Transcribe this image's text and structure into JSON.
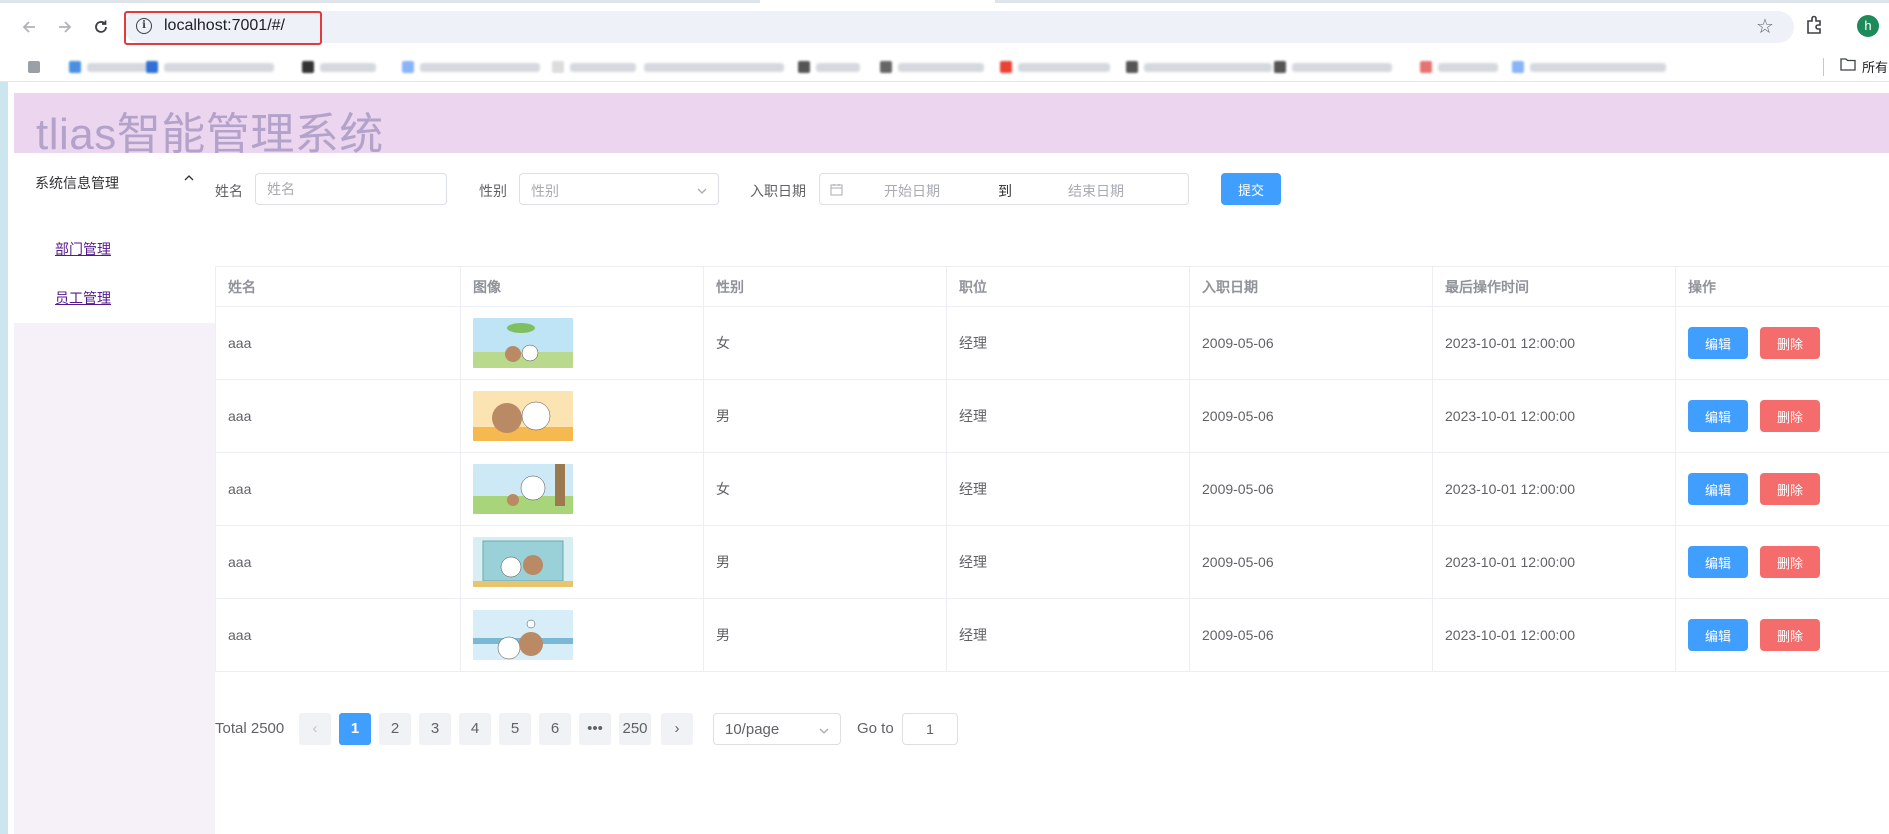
{
  "browser": {
    "url": "localhost:7001/#/",
    "profile_initial": "h",
    "all_bookmarks_label": "所有"
  },
  "app": {
    "title": "tlias智能管理系统"
  },
  "sidebar": {
    "group_title": "系统信息管理",
    "items": [
      {
        "label": "部门管理"
      },
      {
        "label": "员工管理"
      }
    ]
  },
  "search": {
    "name_label": "姓名",
    "name_placeholder": "姓名",
    "gender_label": "性别",
    "gender_placeholder": "性别",
    "date_label": "入职日期",
    "start_placeholder": "开始日期",
    "range_separator": "到",
    "end_placeholder": "结束日期",
    "submit_label": "提交"
  },
  "table": {
    "columns": [
      "姓名",
      "图像",
      "性别",
      "职位",
      "入职日期",
      "最后操作时间",
      "操作"
    ],
    "edit_label": "编辑",
    "delete_label": "删除",
    "rows": [
      {
        "name": "aaa",
        "gender": "女",
        "job": "经理",
        "entry_date": "2009-05-06",
        "update_time": "2023-10-01 12:00:00"
      },
      {
        "name": "aaa",
        "gender": "男",
        "job": "经理",
        "entry_date": "2009-05-06",
        "update_time": "2023-10-01 12:00:00"
      },
      {
        "name": "aaa",
        "gender": "女",
        "job": "经理",
        "entry_date": "2009-05-06",
        "update_time": "2023-10-01 12:00:00"
      },
      {
        "name": "aaa",
        "gender": "男",
        "job": "经理",
        "entry_date": "2009-05-06",
        "update_time": "2023-10-01 12:00:00"
      },
      {
        "name": "aaa",
        "gender": "男",
        "job": "经理",
        "entry_date": "2009-05-06",
        "update_time": "2023-10-01 12:00:00"
      }
    ]
  },
  "pagination": {
    "total_text": "Total 2500",
    "pages": [
      "1",
      "2",
      "3",
      "4",
      "5",
      "6",
      "•••",
      "250"
    ],
    "current_page": "1",
    "page_size": "10/page",
    "goto_label": "Go to",
    "goto_value": "1"
  },
  "colors": {
    "primary": "#409eff",
    "danger": "#f56c6c",
    "header_bg": "#ecd5ee",
    "title_color": "#b3a2c9",
    "aside_bg": "#f6f0f8"
  }
}
